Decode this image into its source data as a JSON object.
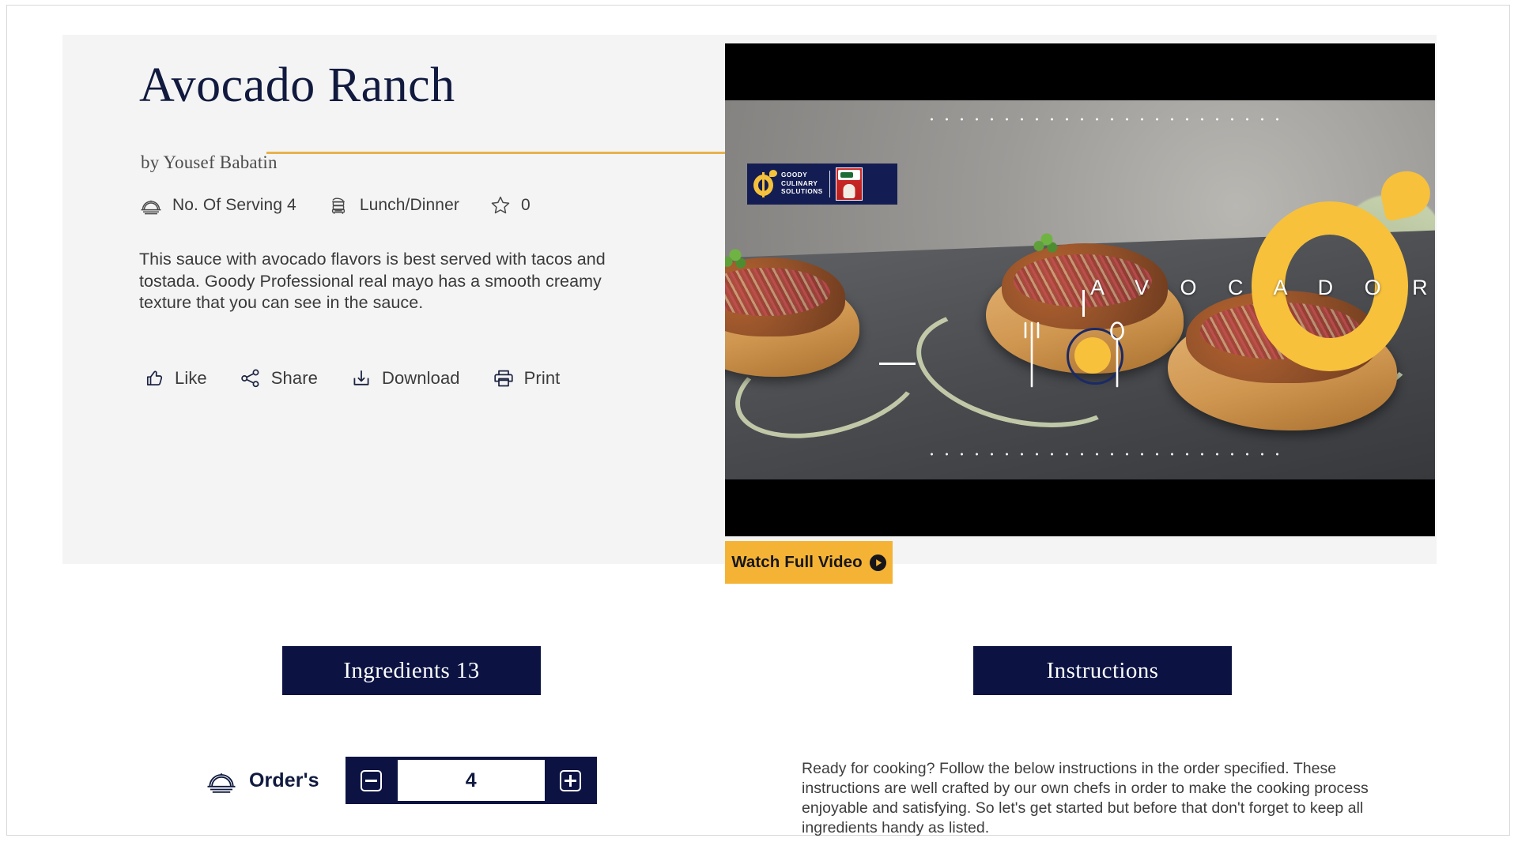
{
  "recipe": {
    "title": "Avocado Ranch",
    "byline": "by Yousef Babatin",
    "description": "This sauce with avocado flavors is best served with tacos and tostada. Goody Professional real mayo has a smooth creamy texture that you can see in the sauce.",
    "meta": [
      {
        "icon": "serving-dome-icon",
        "label": "No. Of Serving 4"
      },
      {
        "icon": "steamer-pot-icon",
        "label": "Lunch/Dinner"
      },
      {
        "icon": "star-outline-icon",
        "label": "0"
      }
    ]
  },
  "actions": [
    {
      "icon": "thumbs-up-icon",
      "label": "Like"
    },
    {
      "icon": "share-nodes-icon",
      "label": "Share"
    },
    {
      "icon": "download-icon",
      "label": "Download"
    },
    {
      "icon": "printer-icon",
      "label": "Print"
    }
  ],
  "video": {
    "brand_line1": "GOODY",
    "brand_line2": "CULINARY",
    "brand_line3": "SOLUTIONS",
    "product_brand": "GOODY",
    "overlay_word": "A V O C A D O   R",
    "watch_button": "Watch Full Video",
    "play_icon": "play-circle-icon"
  },
  "tabs": {
    "ingredients_label": "Ingredients 13",
    "instructions_label": "Instructions"
  },
  "order": {
    "icon": "serving-dome-icon",
    "label": "Order's",
    "decrement_icon": "minus-square-icon",
    "increment_icon": "plus-square-icon",
    "quantity": "4"
  },
  "instructions": {
    "body": "Ready for cooking? Follow the below instructions in the order specified. These instructions are well crafted by our own chefs in order to make the cooking process enjoyable and satisfying. So let's get started but before that don't forget to keep all ingredients handy as listed."
  },
  "colors": {
    "navy": "#0c1343",
    "amber": "#f5b335",
    "gold_rule": "#e8b24c",
    "card_bg": "#f4f4f5",
    "logo_yellow": "#f7c13c"
  }
}
